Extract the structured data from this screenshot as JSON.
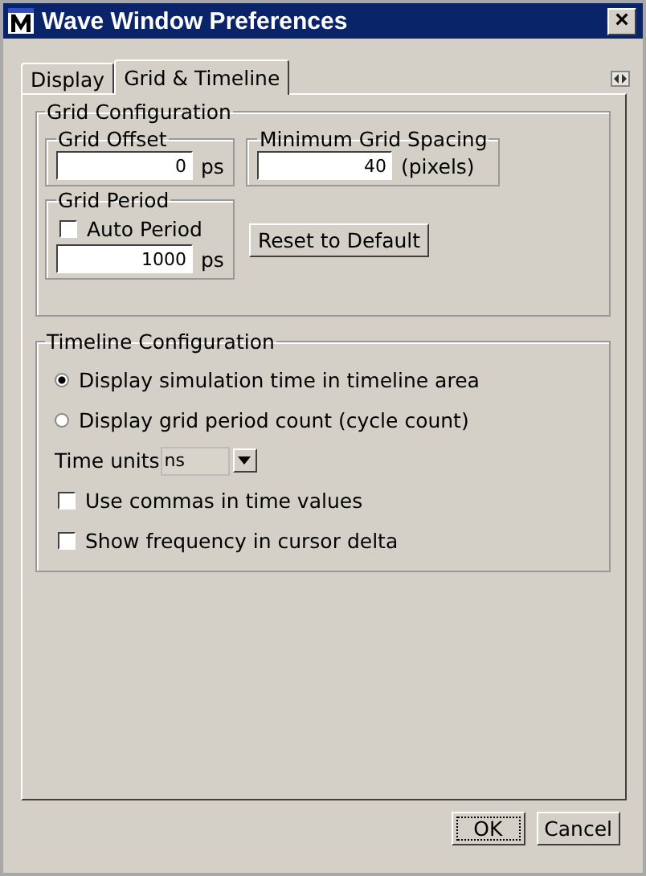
{
  "window": {
    "title": "Wave Window Preferences",
    "close": "×"
  },
  "tabs": [
    {
      "label": "Display",
      "selected": false
    },
    {
      "label": "Grid & Timeline",
      "selected": true
    }
  ],
  "grid_configuration": {
    "title": "Grid Configuration",
    "grid_offset": {
      "title": "Grid Offset",
      "value": "0",
      "unit": "ps"
    },
    "minimum_grid_spacing": {
      "title": "Minimum Grid Spacing",
      "value": "40",
      "unit": "(pixels)"
    },
    "grid_period": {
      "title": "Grid Period",
      "auto_period": {
        "label": "Auto Period",
        "checked": false
      },
      "value": "1000",
      "unit": "ps"
    },
    "reset_button": "Reset to Default"
  },
  "timeline_configuration": {
    "title": "Timeline Configuration",
    "modes": [
      {
        "label": "Display simulation time in timeline area",
        "selected": true
      },
      {
        "label": "Display grid period count (cycle count)",
        "selected": false
      }
    ],
    "time_units": {
      "label": "Time units",
      "value": "ns"
    },
    "options": [
      {
        "label": "Use commas in time values",
        "checked": false
      },
      {
        "label": "Show frequency in cursor delta",
        "checked": false
      }
    ]
  },
  "buttons": [
    "OK",
    "Cancel"
  ]
}
